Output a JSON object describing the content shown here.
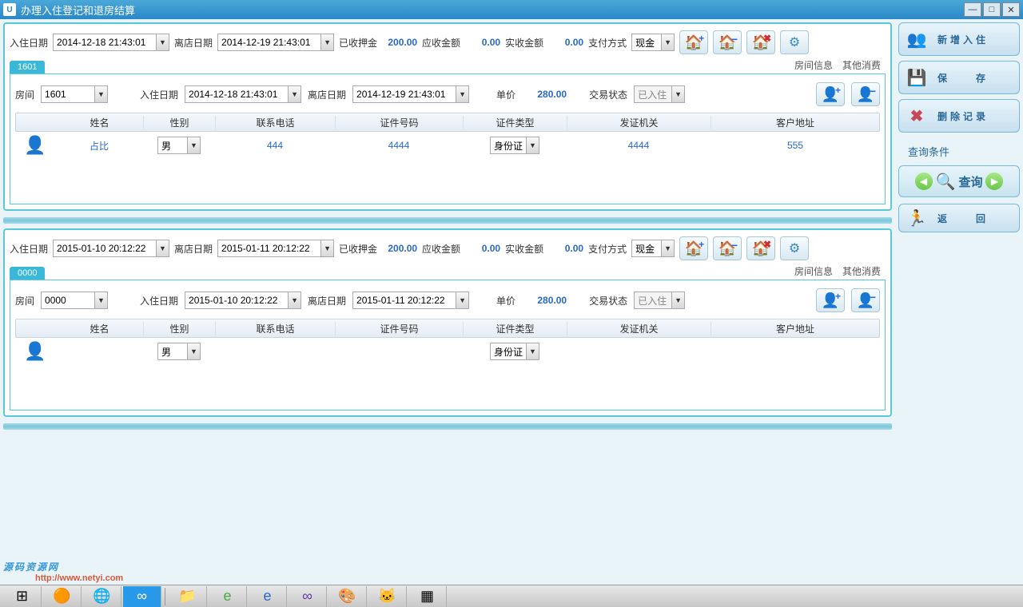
{
  "window": {
    "title": "办理入住登记和退房结算"
  },
  "sidebar": {
    "add_checkin": "新增入住",
    "save": "保　　存",
    "delete": "删除记录",
    "query_cond": "查询条件",
    "query": "查询",
    "back": "返　　回"
  },
  "labels": {
    "checkin_date": "入住日期",
    "checkout_date": "离店日期",
    "deposit_paid": "已收押金",
    "receivable": "应收金额",
    "received": "实收金额",
    "pay_method": "支付方式",
    "room": "房间",
    "unit_price": "单价",
    "txn_status": "交易状态",
    "room_info": "房间信息",
    "other_spend": "其他消费"
  },
  "grid_headers": {
    "name": "姓名",
    "gender": "性别",
    "phone": "联系电话",
    "idnum": "证件号码",
    "idtype": "证件类型",
    "issuer": "发证机关",
    "addr": "客户地址"
  },
  "pay_cash": "现金",
  "status_in": "已入住",
  "records": [
    {
      "tab": "1601",
      "checkin": "2014-12-18 21:43:01",
      "checkout": "2014-12-19 21:43:01",
      "deposit": "200.00",
      "receivable": "0.00",
      "received": "0.00",
      "room": "1601",
      "price": "280.00",
      "guests": [
        {
          "name": "占比",
          "gender": "男",
          "phone": "444",
          "idnum": "4444",
          "idtype": "身份证",
          "issuer": "4444",
          "addr": "555"
        }
      ]
    },
    {
      "tab": "0000",
      "checkin": "2015-01-10 20:12:22",
      "checkout": "2015-01-11 20:12:22",
      "deposit": "200.00",
      "receivable": "0.00",
      "received": "0.00",
      "room": "0000",
      "price": "280.00",
      "guests": [
        {
          "name": "",
          "gender": "男",
          "phone": "",
          "idnum": "",
          "idtype": "身份证",
          "issuer": "",
          "addr": ""
        }
      ]
    }
  ],
  "watermark": {
    "text": "源码资源网",
    "url": "http://www.netyi.com"
  }
}
